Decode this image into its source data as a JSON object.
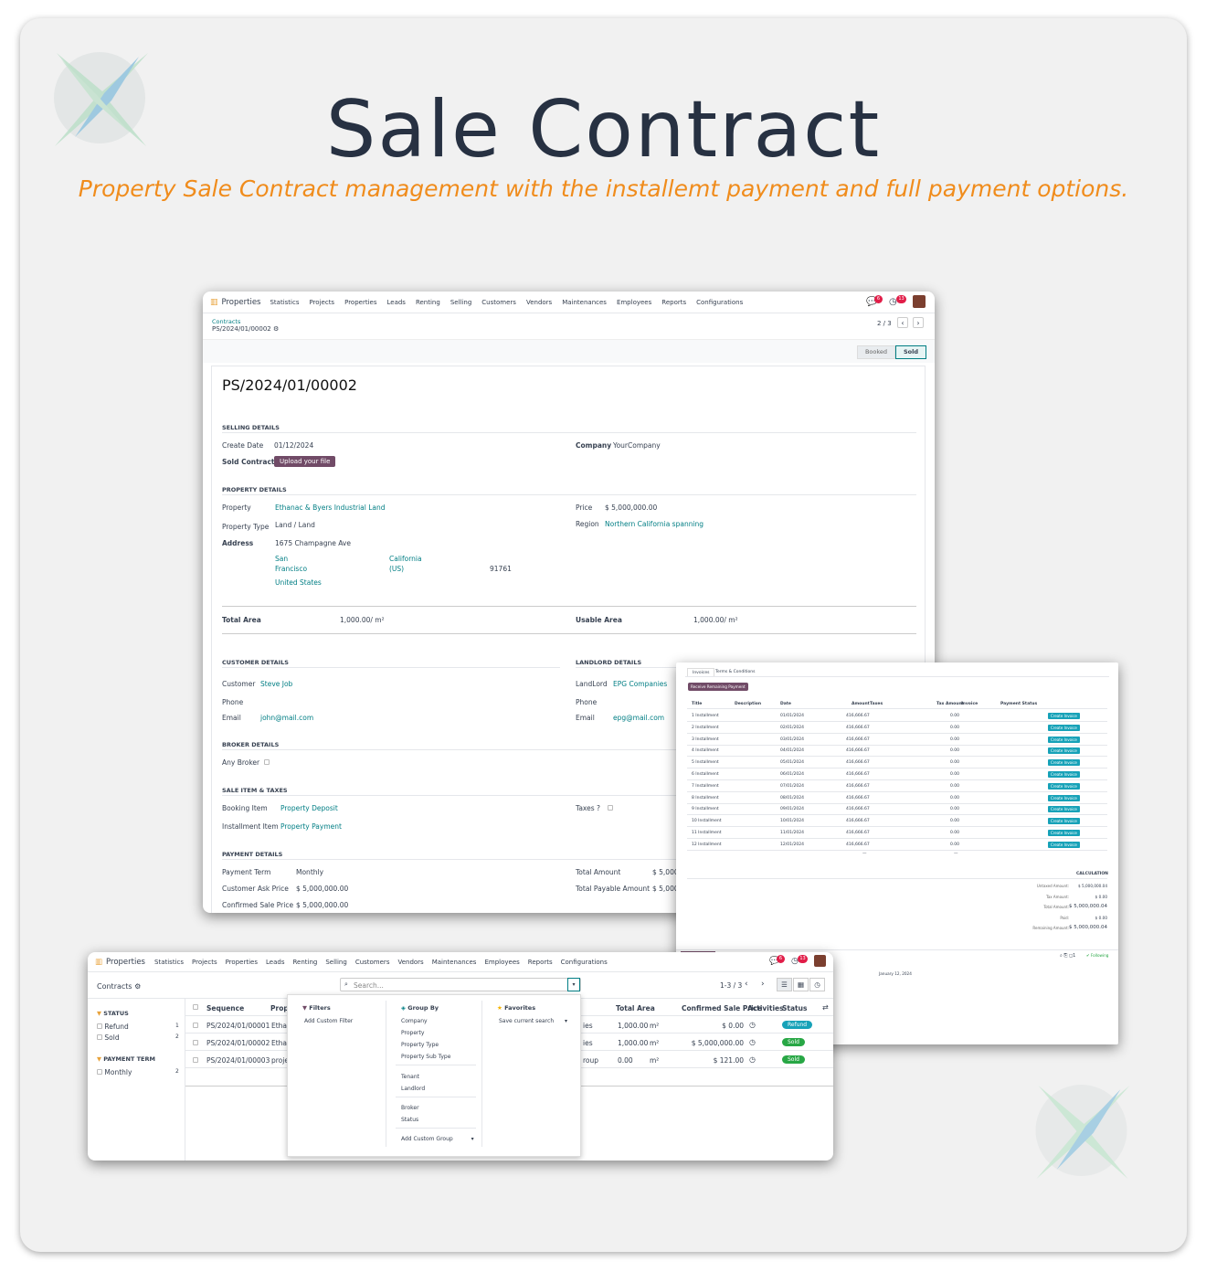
{
  "hero": {
    "title": "Sale Contract",
    "subtitle": "Property Sale Contract management with the installemt payment and full payment options."
  },
  "nav": {
    "app": "Properties",
    "menu": [
      "Statistics",
      "Projects",
      "Properties",
      "Leads",
      "Renting",
      "Selling",
      "Customers",
      "Vendors",
      "Maintenances",
      "Employees",
      "Reports",
      "Configurations"
    ],
    "chat_count": "6",
    "activity_count": "13"
  },
  "form": {
    "breadcrumb": "Contracts",
    "record": "PS/2024/01/00002",
    "pager": "2 / 3",
    "stages": [
      "Booked",
      "Sold"
    ],
    "title": "PS/2024/01/00002",
    "selling": {
      "heading": "SELLING DETAILS",
      "create_date_label": "Create Date",
      "create_date": "01/12/2024",
      "company_label": "Company",
      "company": "YourCompany",
      "sold_contract_label": "Sold Contract",
      "upload": "Upload your file"
    },
    "property": {
      "heading": "PROPERTY DETAILS",
      "property_label": "Property",
      "property": "Ethanac & Byers Industrial Land",
      "price_label": "Price",
      "price": "$ 5,000,000.00",
      "type_label": "Property Type",
      "type": "Land / Land",
      "region_label": "Region",
      "region": "Northern California spanning",
      "address_label": "Address",
      "street": "1675 Champagne Ave",
      "city1": "San",
      "city2": "Francisco",
      "state1": "California",
      "state2": "(US)",
      "zip": "91761",
      "country": "United States",
      "total_area_label": "Total Area",
      "total_area": "1,000.00/ m²",
      "usable_area_label": "Usable Area",
      "usable_area": "1,000.00/ m²"
    },
    "customer": {
      "heading": "CUSTOMER DETAILS",
      "customer_label": "Customer",
      "customer": "Steve Job",
      "phone_label": "Phone",
      "email_label": "Email",
      "email": "john@mail.com"
    },
    "landlord": {
      "heading": "LANDLORD DETAILS",
      "landlord_label": "LandLord",
      "landlord": "EPG Companies",
      "phone_label": "Phone",
      "email_label": "Email",
      "email": "epg@mail.com"
    },
    "broker": {
      "heading": "BROKER DETAILS",
      "any_label": "Any Broker"
    },
    "sale_items": {
      "heading": "SALE ITEM & TAXES",
      "booking_label": "Booking Item",
      "booking": "Property Deposit",
      "taxes_label": "Taxes ?",
      "installment_label": "Installment Item",
      "installment": "Property Payment"
    },
    "payment": {
      "heading": "PAYMENT DETAILS",
      "term_label": "Payment Term",
      "term": "Monthly",
      "ask_label": "Customer Ask Price",
      "ask": "$ 5,000,000.00",
      "confirmed_label": "Confirmed Sale Price",
      "confirmed": "$ 5,000,000.00",
      "total_label": "Total Amount",
      "total": "$ 5,000",
      "payable_label": "Total Payable Amount",
      "payable": "$ 5,000"
    }
  },
  "invoices": {
    "tabs": [
      "Invoices",
      "Terms & Conditions"
    ],
    "receive_btn": "Receive Remaining Payment",
    "headers": [
      "Title",
      "Description",
      "Date",
      "Amount",
      "Taxes",
      "Tax Amount",
      "Invoice",
      "Payment Status"
    ],
    "rows": [
      [
        "1 Installment",
        "01/01/2024",
        "416,666.67",
        "0.00",
        "Create Invoice"
      ],
      [
        "2 Installment",
        "02/01/2024",
        "416,666.67",
        "0.00",
        "Create Invoice"
      ],
      [
        "3 Installment",
        "03/01/2024",
        "416,666.67",
        "0.00",
        "Create Invoice"
      ],
      [
        "4 Installment",
        "04/01/2024",
        "416,666.67",
        "0.00",
        "Create Invoice"
      ],
      [
        "5 Installment",
        "05/01/2024",
        "416,666.67",
        "0.00",
        "Create Invoice"
      ],
      [
        "6 Installment",
        "06/01/2024",
        "416,666.67",
        "0.00",
        "Create Invoice"
      ],
      [
        "7 Installment",
        "07/01/2024",
        "416,666.67",
        "0.00",
        "Create Invoice"
      ],
      [
        "8 Installment",
        "08/01/2024",
        "416,666.67",
        "0.00",
        "Create Invoice"
      ],
      [
        "9 Installment",
        "09/01/2024",
        "416,666.67",
        "0.00",
        "Create Invoice"
      ],
      [
        "10 Installment",
        "10/01/2024",
        "416,666.67",
        "0.00",
        "Create Invoice"
      ],
      [
        "11 Installment",
        "11/01/2024",
        "416,666.67",
        "0.00",
        "Create Invoice"
      ],
      [
        "12 Installment",
        "12/01/2024",
        "416,666.67",
        "0.00",
        "Create Invoice"
      ]
    ],
    "calc_heading": "CALCULATION",
    "calc": [
      [
        "Untaxed Amount:",
        "$ 5,000,000.04"
      ],
      [
        "Tax Amount:",
        "$ 0.00"
      ],
      [
        "Total Amount:",
        "$ 5,000,000.04"
      ],
      [
        "Paid:",
        "$ 0.00"
      ],
      [
        "Remaining Amount:",
        "$ 5,000,000.04"
      ]
    ],
    "following": "Following",
    "chatter_date": "January 12, 2024",
    "chatter_counts": "1"
  },
  "list": {
    "breadcrumb": "Contracts",
    "search_placeholder": "Search...",
    "pager": "1-3 / 3",
    "side": {
      "status_heading": "STATUS",
      "status": [
        [
          "Refund",
          "1"
        ],
        [
          "Sold",
          "2"
        ]
      ],
      "term_heading": "PAYMENT TERM",
      "term": [
        [
          "Monthly",
          "2"
        ]
      ]
    },
    "headers": [
      "Sequence",
      "Prope",
      "Total Area",
      "Confirmed Sale Price",
      "Activities",
      "Status"
    ],
    "rows": [
      {
        "seq": "PS/2024/01/00001",
        "prop": "Etha",
        "tail": "ies",
        "area": "1,000.00",
        "unit": "m²",
        "price": "$ 0.00",
        "status": "Refund",
        "color": "#17a2b8"
      },
      {
        "seq": "PS/2024/01/00002",
        "prop": "Etha",
        "tail": "ies",
        "area": "1,000.00",
        "unit": "m²",
        "price": "$ 5,000,000.00",
        "status": "Sold",
        "color": "#28a745"
      },
      {
        "seq": "PS/2024/01/00003",
        "prop": "proje",
        "tail": "roup",
        "area": "0.00",
        "unit": "m²",
        "price": "$ 121.00",
        "status": "Sold",
        "color": "#28a745"
      }
    ],
    "filters": {
      "heading": "Filters",
      "add": "Add Custom Filter"
    },
    "groupby": {
      "heading": "Group By",
      "items": [
        "Company",
        "Property",
        "Property Type",
        "Property Sub Type"
      ],
      "items2": [
        "Tenant",
        "Landlord"
      ],
      "items3": [
        "Broker",
        "Status"
      ],
      "add": "Add Custom Group"
    },
    "favorites": {
      "heading": "Favorites",
      "save": "Save current search"
    }
  }
}
